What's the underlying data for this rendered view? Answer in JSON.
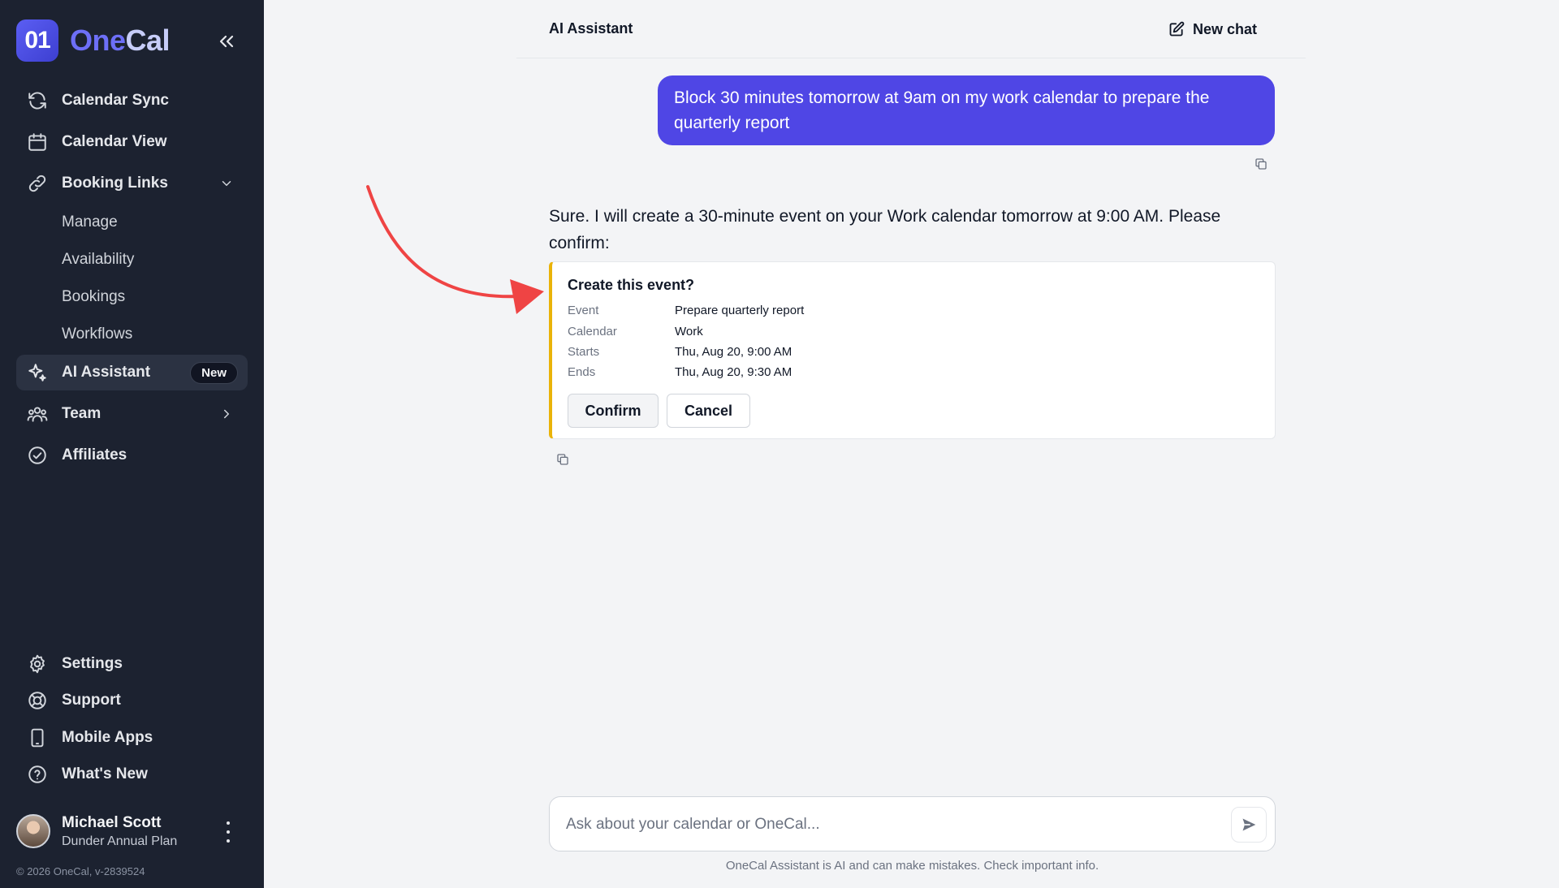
{
  "sidebar": {
    "brand": {
      "logo_text": "01",
      "name_part1": "One",
      "name_part2": "Cal"
    },
    "nav": [
      {
        "label": "Calendar Sync",
        "icon": "sync-icon"
      },
      {
        "label": "Calendar View",
        "icon": "calendar-icon"
      },
      {
        "label": "Booking Links",
        "icon": "link-icon",
        "expanded": true
      },
      {
        "label": "AI Assistant",
        "icon": "sparkle-icon",
        "active": true,
        "badge": "New"
      },
      {
        "label": "Team",
        "icon": "team-icon"
      },
      {
        "label": "Affiliates",
        "icon": "check-circle-icon"
      }
    ],
    "booking_sub": [
      "Manage",
      "Availability",
      "Bookings",
      "Workflows"
    ],
    "bottom_nav": [
      {
        "label": "Settings",
        "icon": "gear-icon"
      },
      {
        "label": "Support",
        "icon": "lifebuoy-icon"
      },
      {
        "label": "Mobile Apps",
        "icon": "phone-icon"
      },
      {
        "label": "What's New",
        "icon": "help-circle-icon"
      }
    ],
    "user": {
      "name": "Michael Scott",
      "plan": "Dunder Annual Plan"
    },
    "copyright": "© 2026 OneCal, v-2839524"
  },
  "header": {
    "title": "AI Assistant",
    "new_chat": "New chat"
  },
  "chat": {
    "user_message": "Block 30 minutes tomorrow at 9am on my work calendar to prepare the quarterly report",
    "assistant_message": "Sure. I will create a 30-minute event on your Work calendar tomorrow at 9:00 AM. Please confirm:",
    "card": {
      "title": "Create this event?",
      "rows": [
        {
          "key": "Event",
          "value": "Prepare quarterly report"
        },
        {
          "key": "Calendar",
          "value": "Work"
        },
        {
          "key": "Starts",
          "value": "Thu, Aug 20, 9:00 AM"
        },
        {
          "key": "Ends",
          "value": "Thu, Aug 20, 9:30 AM"
        }
      ],
      "confirm": "Confirm",
      "cancel": "Cancel",
      "accent_color": "#eab308"
    }
  },
  "composer": {
    "placeholder": "Ask about your calendar or OneCal...",
    "disclaimer": "OneCal Assistant is AI and can make mistakes. Check important info."
  },
  "colors": {
    "brand": "#4f46e5",
    "sidebar_bg": "#1c2230",
    "annotation_arrow": "#ef4444"
  }
}
